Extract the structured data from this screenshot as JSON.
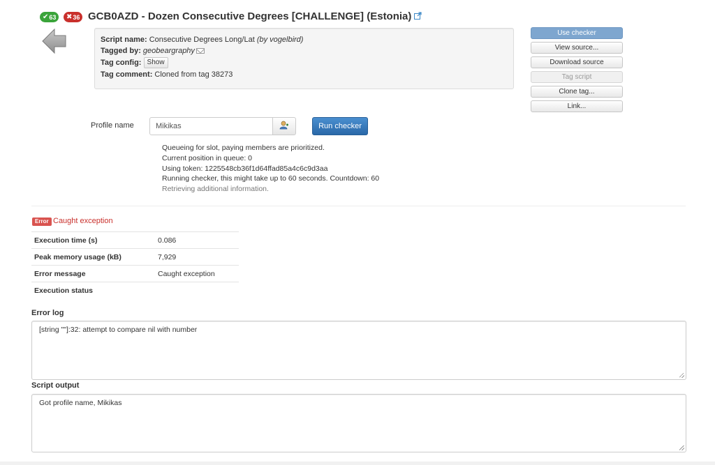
{
  "header": {
    "found_count": "63",
    "dnf_count": "36",
    "title": "GCB0AZD - Dozen Consecutive Degrees [CHALLENGE] (Estonia)"
  },
  "info": {
    "script_name_label": "Script name:",
    "script_name": "Consecutive Degrees Long/Lat",
    "script_author": "(by vogelbird)",
    "tagged_by_label": "Tagged by:",
    "tagged_by": "geobeargraphy",
    "tag_config_label": "Tag config:",
    "tag_config_button": "Show",
    "tag_comment_label": "Tag comment:",
    "tag_comment": "Cloned from tag 38273"
  },
  "side_buttons": {
    "use_checker": "Use checker",
    "view_source": "View source...",
    "download_source": "Download source",
    "tag_script": "Tag script",
    "clone_tag": "Clone tag...",
    "link": "Link..."
  },
  "profile": {
    "label": "Profile name",
    "value": "Mikikas",
    "run_button": "Run checker"
  },
  "status": {
    "line1": "Queueing for slot, paying members are prioritized.",
    "line2": "Current position in queue: 0",
    "line3": "Using token: 1225548cb36f1d64ffad85a4c6c9d3aa",
    "line4": "Running checker, this might take up to 60 seconds. Countdown: 60",
    "line5": "Retrieving additional information."
  },
  "result": {
    "error_badge": "Error",
    "error_text": "Caught exception",
    "rows": [
      {
        "key": "Execution time (s)",
        "value": "0.086"
      },
      {
        "key": "Peak memory usage (kB)",
        "value": "7,929"
      },
      {
        "key": "Error message",
        "value": "Caught exception"
      },
      {
        "key": "Execution status",
        "value": ""
      }
    ]
  },
  "error_log": {
    "label": "Error log",
    "content": "[string \"\"]:32: attempt to compare nil with number"
  },
  "script_output": {
    "label": "Script output",
    "content": "Got profile name, Mikikas"
  },
  "colors": {
    "primary": "#2a68a8",
    "error": "#d9534f",
    "success": "#3aa43a"
  }
}
